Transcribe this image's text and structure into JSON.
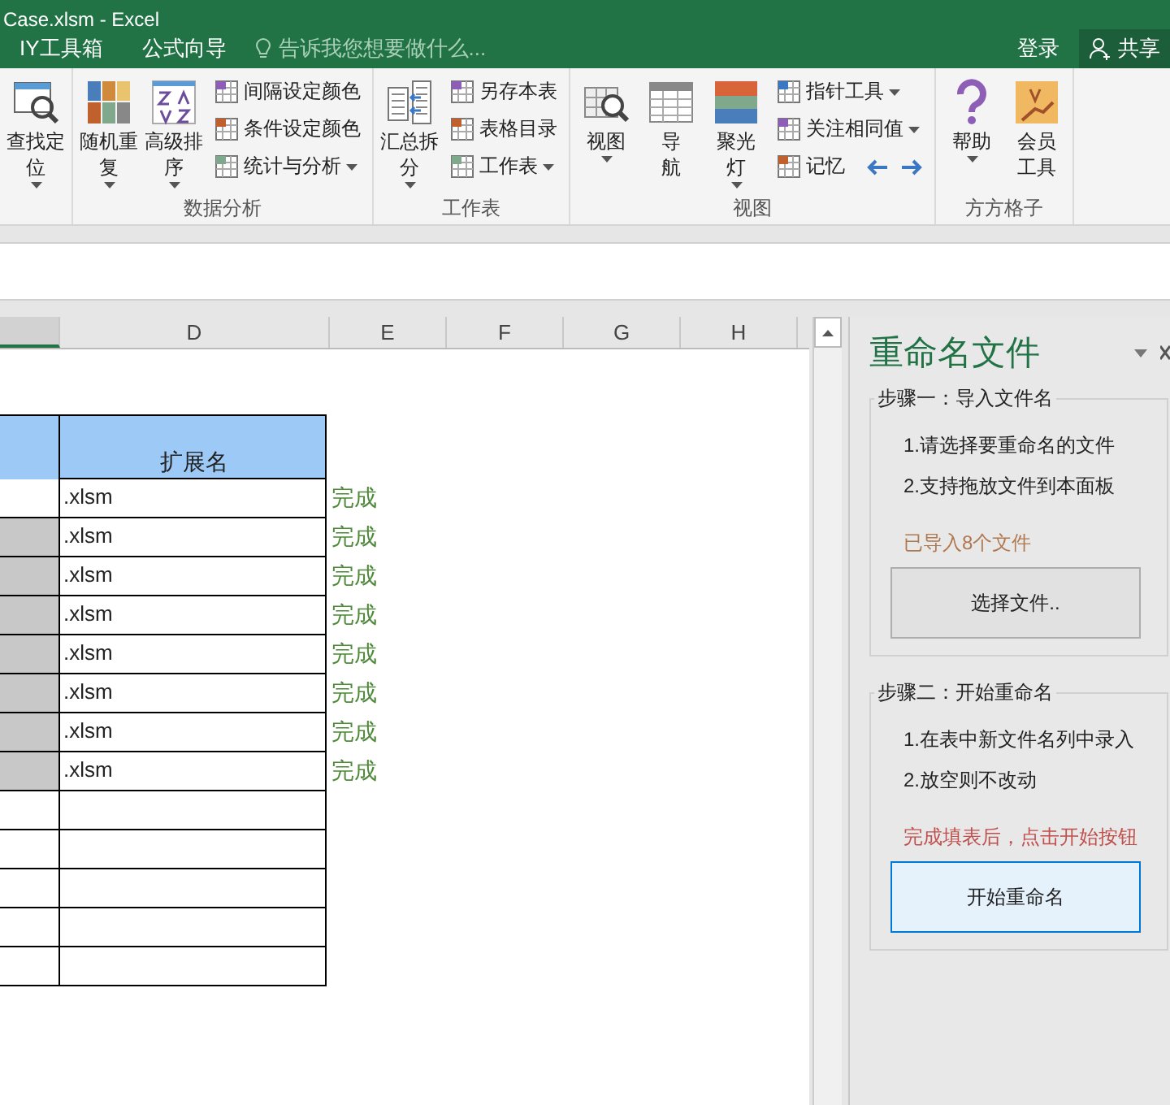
{
  "title_bar": {
    "title": "Case.xlsm - Excel"
  },
  "ribbon_tabs": [
    {
      "label": "IY工具箱"
    },
    {
      "label": "公式向导"
    }
  ],
  "tell_me": {
    "placeholder": "告诉我您想要做什么..."
  },
  "account": {
    "sign_in": "登录",
    "share": "共享"
  },
  "ribbon": {
    "groups": [
      {
        "items": [
          {
            "kind": "large",
            "label": [
              "查找定",
              "位"
            ],
            "dropdown": true
          }
        ]
      },
      {
        "label": "数据分析",
        "items": [
          {
            "kind": "large",
            "label": [
              "随机重",
              "复"
            ],
            "dropdown": true
          },
          {
            "kind": "large",
            "label": [
              "高级排",
              "序"
            ],
            "dropdown": true
          },
          {
            "kind": "small",
            "label": [
              "间隔设定颜色"
            ],
            "dropdown": false
          },
          {
            "kind": "small",
            "label": [
              "条件设定颜色"
            ],
            "dropdown": false
          },
          {
            "kind": "small",
            "label": [
              "统计与分析"
            ],
            "dropdown": true
          }
        ]
      },
      {
        "label": "工作表",
        "items": [
          {
            "kind": "large",
            "label": [
              "汇总拆",
              "分"
            ],
            "dropdown": true
          },
          {
            "kind": "small",
            "label": [
              "另存本表"
            ],
            "dropdown": false
          },
          {
            "kind": "small",
            "label": [
              "表格目录"
            ],
            "dropdown": false
          },
          {
            "kind": "small",
            "label": [
              "工作表"
            ],
            "dropdown": true
          }
        ]
      },
      {
        "label": "视图",
        "items": [
          {
            "kind": "large",
            "label": [
              "视图"
            ],
            "dropdown": true
          },
          {
            "kind": "large",
            "label": [
              "导",
              "航"
            ],
            "dropdown": false
          },
          {
            "kind": "large",
            "label": [
              "聚光",
              "灯"
            ],
            "dropdown": true
          },
          {
            "kind": "small",
            "label": [
              "指针工具"
            ],
            "dropdown": true
          },
          {
            "kind": "small",
            "label": [
              "关注相同值"
            ],
            "dropdown": true
          },
          {
            "kind": "small",
            "label": [
              "记忆"
            ],
            "dropdown": false,
            "arrows": true
          }
        ]
      },
      {
        "label": "方方格子",
        "items": [
          {
            "kind": "large",
            "label": [
              "帮助"
            ],
            "dropdown": true
          },
          {
            "kind": "large",
            "label": [
              "会员",
              "工具"
            ],
            "dropdown": false
          }
        ]
      }
    ]
  },
  "sheet": {
    "columns": [
      "D",
      "E",
      "F",
      "G",
      "H"
    ],
    "header": "扩展名",
    "rows": [
      {
        "extension": ".xlsm",
        "status": "完成",
        "selected": false
      },
      {
        "extension": ".xlsm",
        "status": "完成",
        "selected": true
      },
      {
        "extension": ".xlsm",
        "status": "完成",
        "selected": true
      },
      {
        "extension": ".xlsm",
        "status": "完成",
        "selected": true
      },
      {
        "extension": ".xlsm",
        "status": "完成",
        "selected": true
      },
      {
        "extension": ".xlsm",
        "status": "完成",
        "selected": true
      },
      {
        "extension": ".xlsm",
        "status": "完成",
        "selected": true
      },
      {
        "extension": ".xlsm",
        "status": "完成",
        "selected": true
      }
    ]
  },
  "pane": {
    "title": "重命名文件",
    "steps": [
      {
        "heading": "步骤一：导入文件名",
        "lines": [
          "1.请选择要重命名的文件",
          "2.支持拖放文件到本面板"
        ],
        "note": "已导入8个文件",
        "color": "#b07850",
        "button": {
          "label": "选择文件..",
          "hovered": false
        }
      },
      {
        "heading": "步骤二：开始重命名",
        "lines": [
          "1.在表中新文件名列中录入",
          "2.放空则不改动"
        ],
        "note": "完成填表后，点击开始按钮",
        "color": "#c0504d",
        "button": {
          "label": "开始重命名",
          "hovered": true
        }
      }
    ]
  }
}
